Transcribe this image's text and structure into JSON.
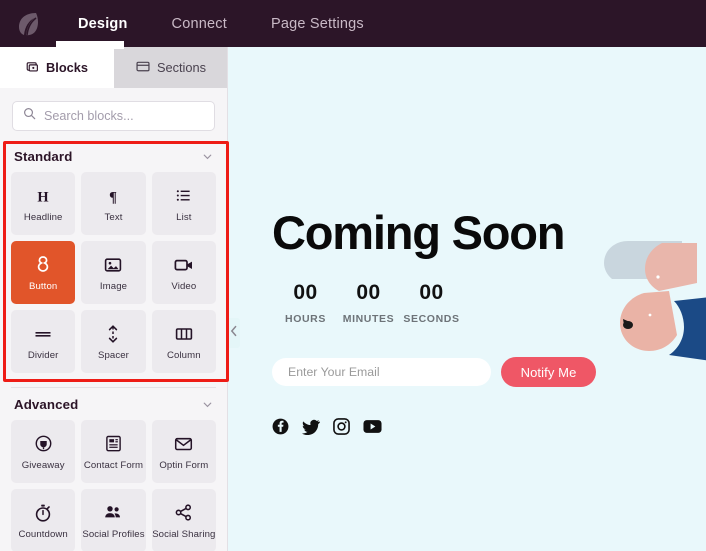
{
  "app": {
    "logo_icon": "leaf-logo-icon",
    "nav": [
      {
        "label": "Design",
        "active": true
      },
      {
        "label": "Connect",
        "active": false
      },
      {
        "label": "Page Settings",
        "active": false
      }
    ]
  },
  "sidebar": {
    "tabs": [
      {
        "label": "Blocks",
        "icon": "blocks-icon",
        "active": true
      },
      {
        "label": "Sections",
        "icon": "sections-icon",
        "active": false
      }
    ],
    "search": {
      "placeholder": "Search blocks...",
      "value": "",
      "icon": "search-icon"
    },
    "groups": [
      {
        "title": "Standard",
        "chevron": "chevron-down-icon",
        "highlighted": true,
        "blocks": [
          {
            "label": "Headline",
            "icon": "headline-icon",
            "selected": false
          },
          {
            "label": "Text",
            "icon": "paragraph-icon",
            "selected": false
          },
          {
            "label": "List",
            "icon": "list-icon",
            "selected": false
          },
          {
            "label": "Button",
            "icon": "button-cursor-icon",
            "selected": true
          },
          {
            "label": "Image",
            "icon": "image-icon",
            "selected": false
          },
          {
            "label": "Video",
            "icon": "video-camera-icon",
            "selected": false
          },
          {
            "label": "Divider",
            "icon": "divider-icon",
            "selected": false
          },
          {
            "label": "Spacer",
            "icon": "spacer-arrows-icon",
            "selected": false
          },
          {
            "label": "Column",
            "icon": "columns-icon",
            "selected": false
          }
        ]
      },
      {
        "title": "Advanced",
        "chevron": "chevron-down-icon",
        "highlighted": false,
        "blocks": [
          {
            "label": "Giveaway",
            "icon": "giveaway-icon",
            "selected": false
          },
          {
            "label": "Contact Form",
            "icon": "contact-form-icon",
            "selected": false
          },
          {
            "label": "Optin Form",
            "icon": "envelope-icon",
            "selected": false
          },
          {
            "label": "Countdown",
            "icon": "stopwatch-icon",
            "selected": false
          },
          {
            "label": "Social Profiles",
            "icon": "people-icon",
            "selected": false
          },
          {
            "label": "Social Sharing",
            "icon": "share-icon",
            "selected": false
          }
        ]
      }
    ],
    "collapse_handle_icon": "chevron-left-icon"
  },
  "preview": {
    "background_color": "#e9f8fb",
    "title": "Coming Soon",
    "countdown": [
      {
        "value": "00",
        "label": "HOURS"
      },
      {
        "value": "00",
        "label": "MINUTES"
      },
      {
        "value": "00",
        "label": "SECONDS"
      }
    ],
    "email_form": {
      "placeholder": "Enter Your Email",
      "value": "",
      "button_label": "Notify Me",
      "button_color": "#ef5766"
    },
    "socials": [
      {
        "name": "facebook-icon"
      },
      {
        "name": "twitter-icon"
      },
      {
        "name": "instagram-icon"
      },
      {
        "name": "youtube-icon"
      }
    ]
  },
  "annotation": {
    "color": "#ee1c16",
    "target": "Standard"
  }
}
